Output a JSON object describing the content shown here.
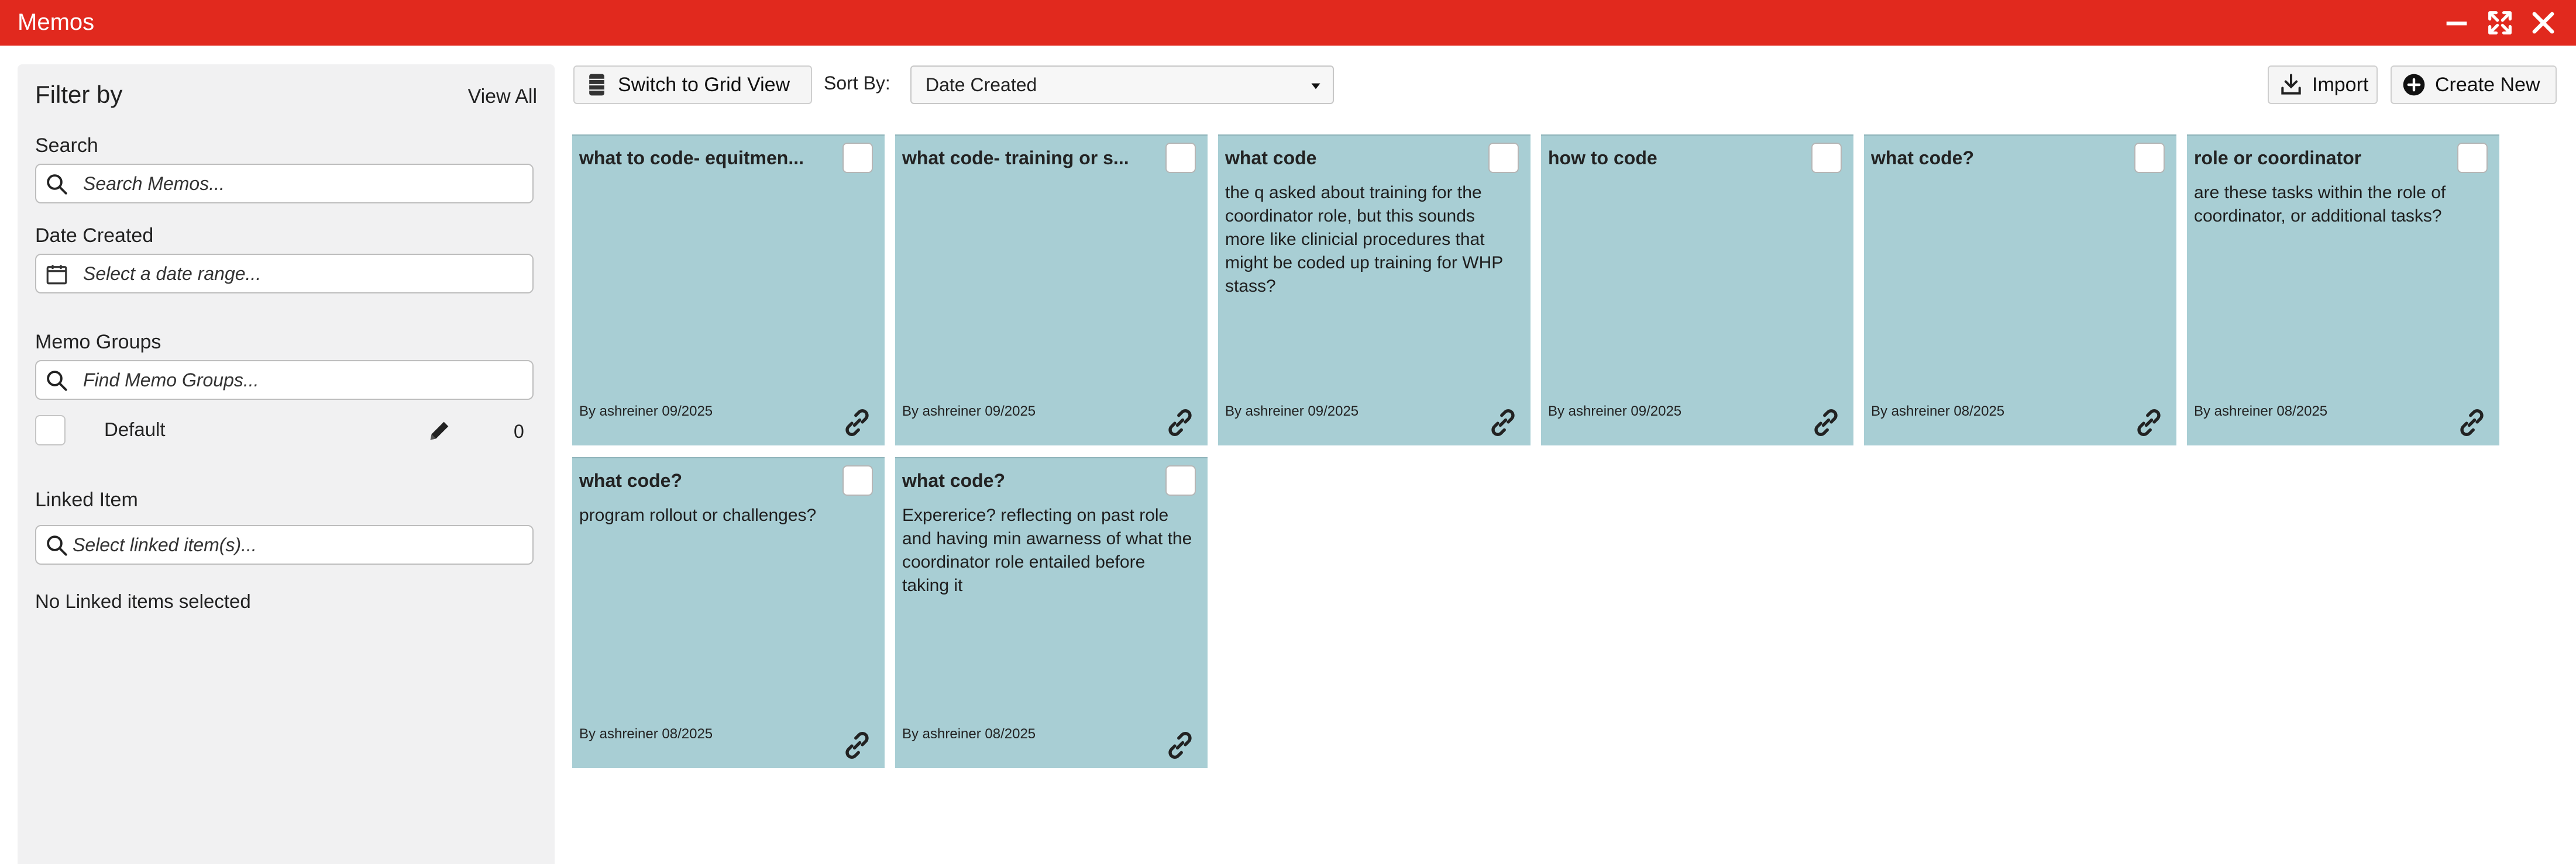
{
  "window": {
    "title": "Memos"
  },
  "sidebar": {
    "title": "Filter by",
    "view_all": "View All",
    "search": {
      "label": "Search",
      "placeholder": "Search Memos..."
    },
    "date_created": {
      "label": "Date Created",
      "placeholder": "Select a date range..."
    },
    "memo_groups": {
      "label": "Memo Groups",
      "placeholder": "Find Memo Groups...",
      "items": [
        {
          "name": "Default",
          "count": "0"
        }
      ]
    },
    "linked_item": {
      "label": "Linked Item",
      "placeholder": "Select linked item(s)...",
      "empty_text": "No Linked items selected"
    }
  },
  "toolbar": {
    "switch_view": "Switch to Grid View",
    "sort_by_label": "Sort By:",
    "sort_by_value": "Date Created",
    "import": "Import",
    "create_new": "Create New"
  },
  "memos": [
    {
      "title": "what to code- equitment",
      "display_title": "what to code- equitmen...",
      "body": "",
      "footer": "By ashreiner 09/2025"
    },
    {
      "title": "what code- training or s",
      "display_title": "what code- training or s...",
      "body": "",
      "footer": "By ashreiner 09/2025"
    },
    {
      "title": "what code",
      "display_title": "what code",
      "body": "the q asked about training for the coordinator role, but this sounds more like clinicial procedures that might be coded up training for WHP stass?",
      "footer": "By ashreiner 09/2025"
    },
    {
      "title": "how to code",
      "display_title": "how to code",
      "body": "",
      "footer": "By ashreiner 09/2025"
    },
    {
      "title": "what code?",
      "display_title": "what code?",
      "body": "",
      "footer": "By ashreiner 08/2025"
    },
    {
      "title": "role or coordinator",
      "display_title": "role or coordinator",
      "body": "are these tasks within the role of coordinator, or additional tasks?",
      "footer": "By ashreiner 08/2025"
    },
    {
      "title": "what code?",
      "display_title": "what code?",
      "body": "program rollout or challenges?",
      "footer": "By ashreiner 08/2025"
    },
    {
      "title": "what code?",
      "display_title": "what code?",
      "body": "Expererice? reflecting on past role and having min awarness of what the coordinator role entailed before taking it",
      "footer": "By ashreiner 08/2025"
    }
  ],
  "colors": {
    "titlebar": "#e1291e",
    "memo_card": "#a8ced4",
    "sidebar_bg": "#f1f1f2"
  }
}
